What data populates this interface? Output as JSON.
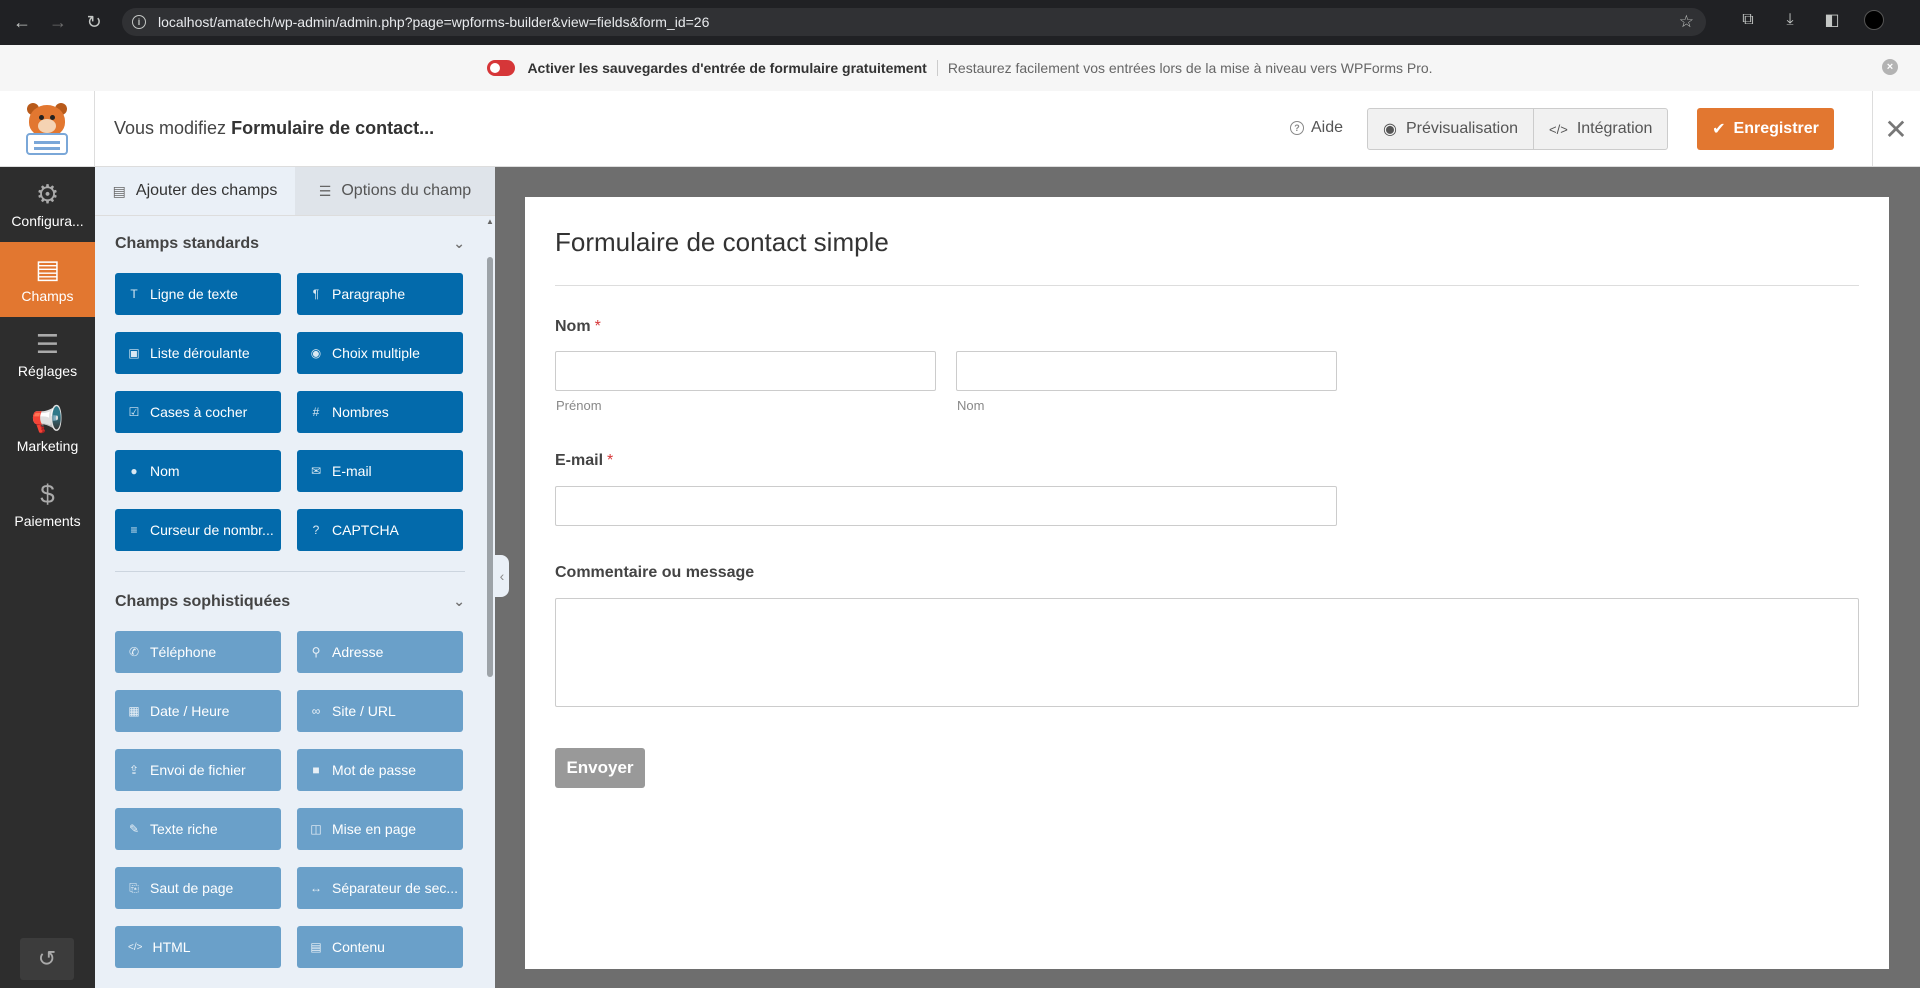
{
  "browser": {
    "url": "localhost/amatech/wp-admin/admin.php?page=wpforms-builder&view=fields&form_id=26"
  },
  "notice": {
    "strong": "Activer les sauvegardes d'entrée de formulaire gratuitement",
    "text": "Restaurez facilement vos entrées lors de la mise à niveau vers WPForms Pro."
  },
  "header": {
    "editing_prefix": "Vous modifiez",
    "form_name": "Formulaire de contact...",
    "help_label": "Aide",
    "preview_label": "Prévisualisation",
    "embed_label": "Intégration",
    "save_label": "Enregistrer"
  },
  "rail": {
    "items": [
      {
        "label": "Configura...",
        "icon": "gear-icon"
      },
      {
        "label": "Champs",
        "icon": "fields-icon"
      },
      {
        "label": "Réglages",
        "icon": "sliders-icon"
      },
      {
        "label": "Marketing",
        "icon": "megaphone-icon"
      },
      {
        "label": "Paiements",
        "icon": "dollar-icon"
      }
    ]
  },
  "panel": {
    "tabs": [
      "Ajouter des champs",
      "Options du champ"
    ],
    "standard_title": "Champs standards",
    "standard_fields": [
      {
        "label": "Ligne de texte",
        "icon": "T"
      },
      {
        "label": "Paragraphe",
        "icon": "¶"
      },
      {
        "label": "Liste déroulante",
        "icon": "▣"
      },
      {
        "label": "Choix multiple",
        "icon": "◉"
      },
      {
        "label": "Cases à cocher",
        "icon": "☑"
      },
      {
        "label": "Nombres",
        "icon": "#"
      },
      {
        "label": "Nom",
        "icon": "●"
      },
      {
        "label": "E-mail",
        "icon": "✉"
      },
      {
        "label": "Curseur de nombr...",
        "icon": "≡"
      },
      {
        "label": "CAPTCHA",
        "icon": "?"
      }
    ],
    "fancy_title": "Champs sophistiquées",
    "fancy_fields": [
      {
        "label": "Téléphone",
        "icon": "✆"
      },
      {
        "label": "Adresse",
        "icon": "⚲"
      },
      {
        "label": "Date / Heure",
        "icon": "▦"
      },
      {
        "label": "Site / URL",
        "icon": "∞"
      },
      {
        "label": "Envoi de fichier",
        "icon": "⇪"
      },
      {
        "label": "Mot de passe",
        "icon": "■"
      },
      {
        "label": "Texte riche",
        "icon": "✎"
      },
      {
        "label": "Mise en page",
        "icon": "◫"
      },
      {
        "label": "Saut de page",
        "icon": "⎘"
      },
      {
        "label": "Séparateur de sec...",
        "icon": "↔"
      },
      {
        "label": "HTML",
        "icon": "</>"
      },
      {
        "label": "Contenu",
        "icon": "▤"
      }
    ]
  },
  "form": {
    "title": "Formulaire de contact simple",
    "name_label": "Nom",
    "first_sublabel": "Prénom",
    "last_sublabel": "Nom",
    "email_label": "E-mail",
    "message_label": "Commentaire ou message",
    "required_mark": "*",
    "submit_label": "Envoyer"
  }
}
